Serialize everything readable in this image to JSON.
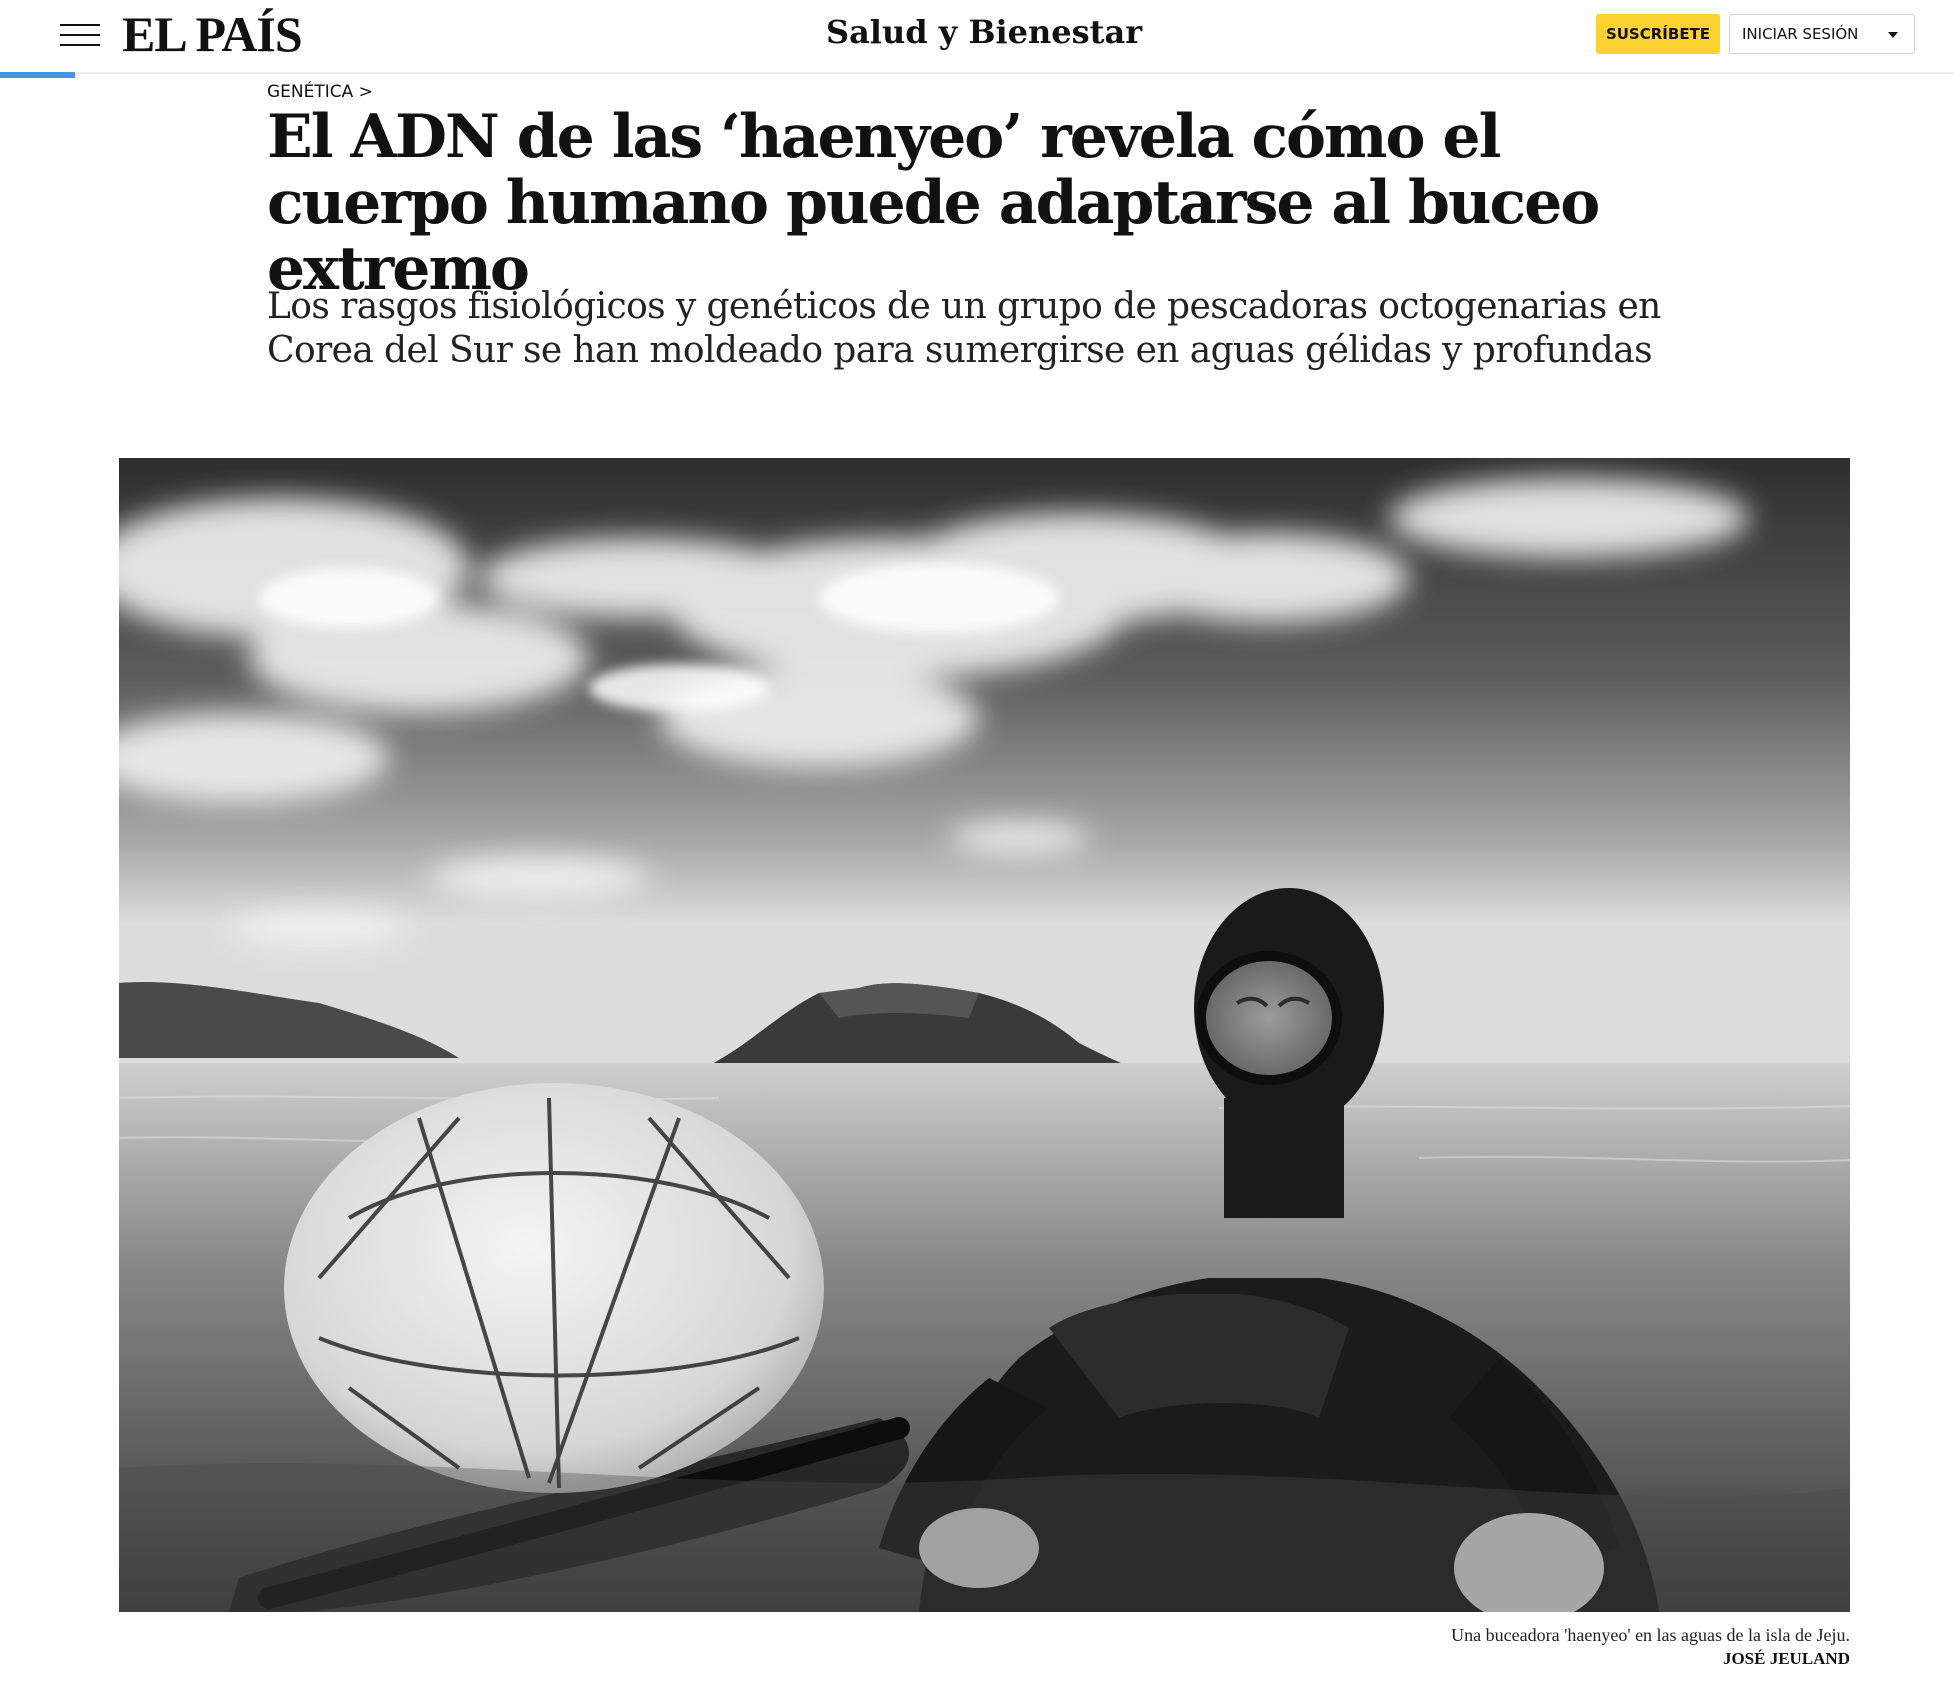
{
  "header": {
    "menu_icon": "hamburger-menu-icon",
    "logo": "EL PAÍS",
    "section": "Salud y Bienestar",
    "subscribe_label": "SUSCRÍBETE",
    "login_label": "INICIAR SESIÓN",
    "login_icon": "caret-down-icon",
    "accent_color": "#3b9ae1",
    "subscribe_color": "#fcd233"
  },
  "article": {
    "breadcrumb": "GENÉTICA >",
    "headline": "El ADN de las ‘haenyeo’ revela cómo el cuerpo humano puede adaptarse al buceo extremo",
    "standfirst": "Los rasgos fisiológicos y genéticos de un grupo de pescadoras octogenarias en Corea del Sur se han moldeado para sumergirse en aguas gélidas y profundas"
  },
  "photo": {
    "caption": "Una buceadora 'haenyeo' en las aguas de la isla de Jeju.",
    "credit": "JOSÉ JEULAND"
  }
}
